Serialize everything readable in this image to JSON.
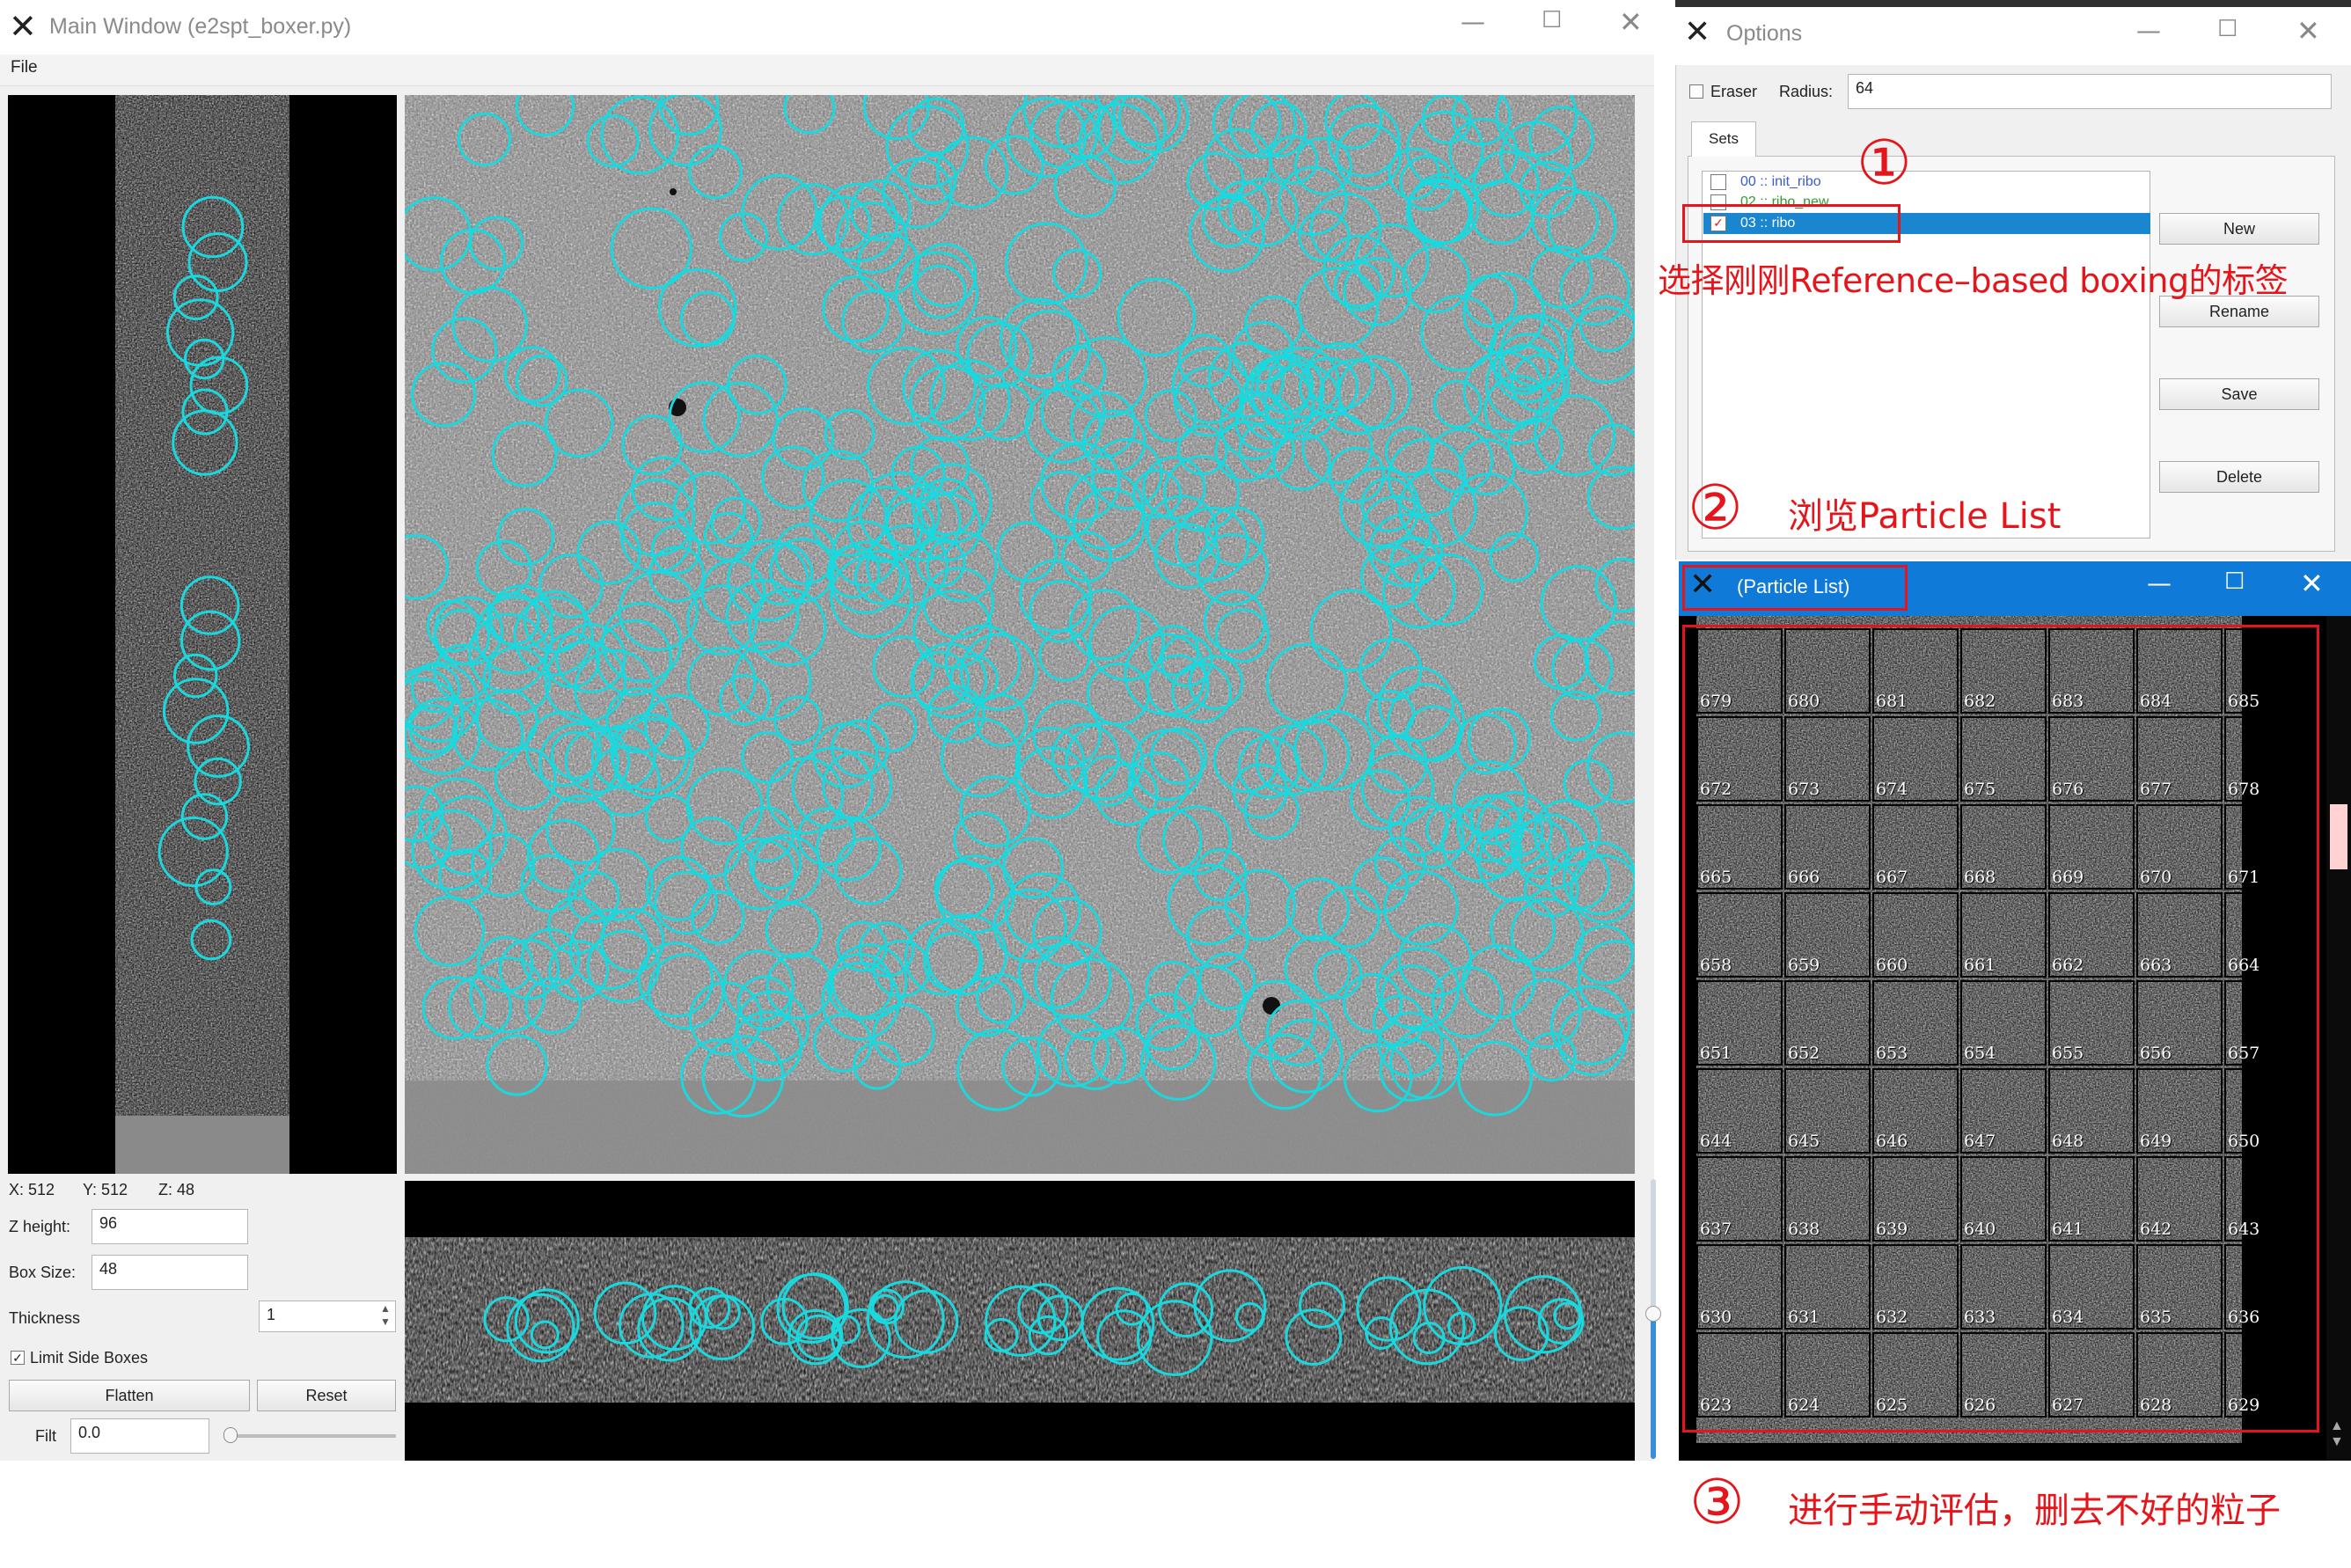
{
  "main_window": {
    "title": "Main Window (e2spt_boxer.py)",
    "menu_file": "File",
    "coords": {
      "x_label": "X: 512",
      "y_label": "Y: 512",
      "z_label": "Z: 48"
    },
    "z_height": {
      "label": "Z height:",
      "value": "96"
    },
    "box_size": {
      "label": "Box Size:",
      "value": "48"
    },
    "thickness": {
      "label": "Thickness",
      "value": "1"
    },
    "limit_side_boxes": {
      "label": "Limit Side Boxes",
      "checked": true
    },
    "flatten_label": "Flatten",
    "reset_label": "Reset",
    "filt": {
      "label": "Filt",
      "value": "0.0"
    },
    "particle_color": "#19d9df"
  },
  "options_window": {
    "title": "Options",
    "eraser_label": "Eraser",
    "radius_label": "Radius:",
    "radius_value": "64",
    "sets_tab": "Sets",
    "sets": [
      {
        "label": "00 :: init_ribo",
        "color": "#3b5bd6",
        "checked": false,
        "selected": false
      },
      {
        "label": "02 :: ribo_new",
        "color": "#2f9e2f",
        "checked": false,
        "selected": false
      },
      {
        "label": "03 :: ribo",
        "color": "#ffffff",
        "checked": true,
        "selected": true
      }
    ],
    "buttons": {
      "new": "New",
      "rename": "Rename",
      "save": "Save",
      "delete": "Delete"
    }
  },
  "particle_list_window": {
    "title": "(Particle List)",
    "rows": [
      [
        679,
        680,
        681,
        682,
        683,
        684,
        685
      ],
      [
        672,
        673,
        674,
        675,
        676,
        677,
        678
      ],
      [
        665,
        666,
        667,
        668,
        669,
        670,
        671
      ],
      [
        658,
        659,
        660,
        661,
        662,
        663,
        664
      ],
      [
        651,
        652,
        653,
        654,
        655,
        656,
        657
      ],
      [
        644,
        645,
        646,
        647,
        648,
        649,
        650
      ],
      [
        637,
        638,
        639,
        640,
        641,
        642,
        643
      ],
      [
        630,
        631,
        632,
        633,
        634,
        635,
        636
      ],
      [
        623,
        624,
        625,
        626,
        627,
        628,
        629
      ]
    ]
  },
  "annotations": {
    "step1_num": "①",
    "step1_text": "选择刚刚Reference–based boxing的标签",
    "step2_num": "②",
    "step2_text": "浏览Particle List",
    "step3_num": "③",
    "step3_text": "进行手动评估，删去不好的粒子",
    "color": "#e4161b"
  }
}
